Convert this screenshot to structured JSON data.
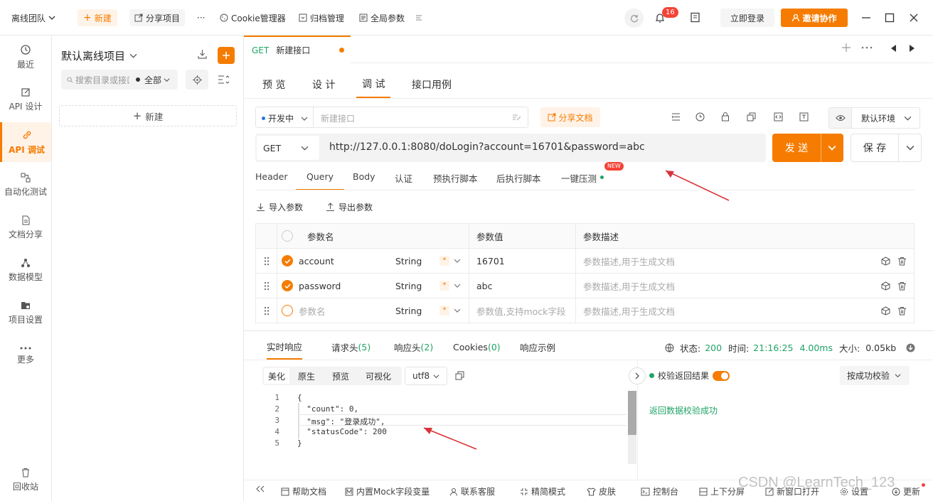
{
  "topbar": {
    "team": "离线团队",
    "new_label": "新建",
    "share_label": "分享项目",
    "more": "···",
    "cookie_label": "Cookie管理器",
    "archive_label": "归档管理",
    "global_params_label": "全局参数",
    "notification_count": "16",
    "login_label": "立即登录",
    "invite_label": "邀请协作"
  },
  "leftnav": {
    "items": [
      {
        "label": "最近",
        "icon": "clock-icon"
      },
      {
        "label": "API 设计",
        "icon": "edit-icon"
      },
      {
        "label": "API 调试",
        "icon": "link-icon"
      },
      {
        "label": "自动化测试",
        "icon": "flow-icon"
      },
      {
        "label": "文档分享",
        "icon": "doc-icon"
      },
      {
        "label": "数据模型",
        "icon": "model-icon"
      },
      {
        "label": "项目设置",
        "icon": "settings-icon"
      },
      {
        "label": "更多",
        "icon": "more-icon"
      }
    ],
    "recycle_label": "回收站"
  },
  "tree": {
    "project_name": "默认离线项目",
    "search_placeholder": "搜索目录或接口",
    "filter_value": "全部",
    "new_label": "新建"
  },
  "tab": {
    "method": "GET",
    "name": "新建接口"
  },
  "subtabs": [
    "预 览",
    "设 计",
    "调 试",
    "接口用例"
  ],
  "request": {
    "status": "开发中",
    "name_placeholder": "新建接口",
    "share_doc_label": "分享文档",
    "env_label": "默认环境",
    "method": "GET",
    "url": "http://127.0.0.1:8080/doLogin?account=16701&password=abc",
    "send_label": "发 送",
    "save_label": "保 存"
  },
  "reqtabs": [
    "Header",
    "Query",
    "Body",
    "认证",
    "预执行脚本",
    "后执行脚本",
    "一键压测"
  ],
  "new_tag": "NEW",
  "param_actions": {
    "import_label": "导入参数",
    "export_label": "导出参数"
  },
  "params_table": {
    "headers": [
      "参数名",
      "参数值",
      "参数描述"
    ],
    "rows": [
      {
        "name": "account",
        "type": "String",
        "required": "*",
        "value": "16701",
        "desc": "参数描述,用于生成文档"
      },
      {
        "name": "password",
        "type": "String",
        "required": "*",
        "value": "abc",
        "desc": "参数描述,用于生成文档"
      },
      {
        "name": "参数名",
        "type": "String",
        "required": "*",
        "value": "参数值,支持mock字段",
        "desc": "参数描述,用于生成文档"
      }
    ]
  },
  "response": {
    "tabs": [
      "实时响应",
      "请求头",
      "响应头",
      "Cookies",
      "响应示例"
    ],
    "req_headers_count": "(5)",
    "resp_headers_count": "(2)",
    "cookies_count": "(0)",
    "status_label": "状态:",
    "status_value": "200",
    "time_label": "时间:",
    "time_value": "21:16:25",
    "duration": "4.00ms",
    "size_label": "大小:",
    "size_value": "0.05kb",
    "view_tabs": [
      "美化",
      "原生",
      "预览",
      "可视化"
    ],
    "encoding": "utf8",
    "code_lines": [
      "{",
      "  \"count\": 0,",
      "  \"msg\": \"登录成功\",",
      "  \"statusCode\": 200",
      "}"
    ],
    "line_numbers": [
      "1",
      "2",
      "3",
      "4",
      "5"
    ],
    "validate_label": "校验返回结果",
    "validate_mode": "按成功校验",
    "validate_result": "返回数据校验成功"
  },
  "statusbar": {
    "items": [
      "帮助文档",
      "内置Mock字段变量",
      "联系客服",
      "精简模式",
      "皮肤",
      "控制台",
      "上下分屏",
      "新窗口打开",
      "设置",
      "更新"
    ]
  },
  "watermark": "CSDN @LearnTech_123",
  "colors": {
    "accent": "#f57c00",
    "success": "#21a366",
    "annotation_arrow": "#d9323a"
  }
}
